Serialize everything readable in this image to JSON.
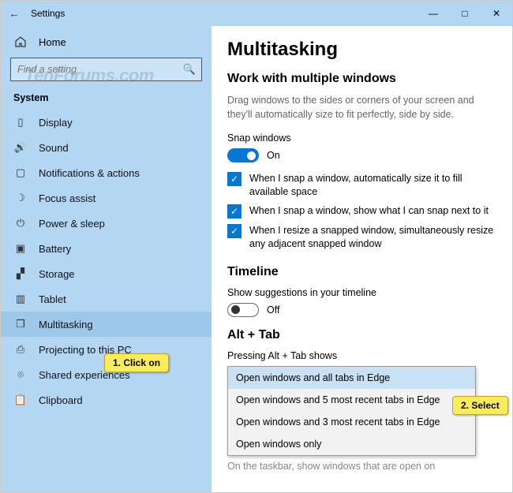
{
  "window": {
    "title": "Settings"
  },
  "watermark": "TenForums.com",
  "sidebar": {
    "home": "Home",
    "search_placeholder": "Find a setting",
    "group": "System",
    "items": [
      {
        "label": "Display"
      },
      {
        "label": "Sound"
      },
      {
        "label": "Notifications & actions"
      },
      {
        "label": "Focus assist"
      },
      {
        "label": "Power & sleep"
      },
      {
        "label": "Battery"
      },
      {
        "label": "Storage"
      },
      {
        "label": "Tablet"
      },
      {
        "label": "Multitasking"
      },
      {
        "label": "Projecting to this PC"
      },
      {
        "label": "Shared experiences"
      },
      {
        "label": "Clipboard"
      }
    ]
  },
  "main": {
    "heading": "Multitasking",
    "section1": {
      "title": "Work with multiple windows",
      "desc": "Drag windows to the sides or corners of your screen and they'll automatically size to fit perfectly, side by side.",
      "snap_label": "Snap windows",
      "snap_state": "On",
      "chk1": "When I snap a window, automatically size it to fill available space",
      "chk2": "When I snap a window, show what I can snap next to it",
      "chk3": "When I resize a snapped window, simultaneously resize any adjacent snapped window"
    },
    "section2": {
      "title": "Timeline",
      "label": "Show suggestions in your timeline",
      "state": "Off"
    },
    "section3": {
      "title": "Alt + Tab",
      "label": "Pressing Alt + Tab shows",
      "options": [
        "Open windows and all tabs in Edge",
        "Open windows and 5 most recent tabs in Edge",
        "Open windows and 3 most recent tabs in Edge",
        "Open windows only"
      ],
      "footer": "On the taskbar, show windows that are open on"
    }
  },
  "callouts": {
    "c1": "1. Click on",
    "c2": "2. Select"
  }
}
